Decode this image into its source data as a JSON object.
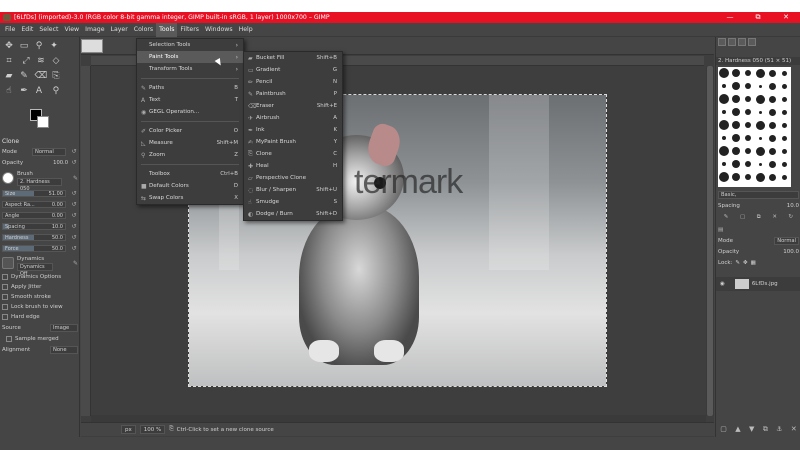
{
  "window": {
    "title": "[6LfDs] (imported)-3.0 (RGB color 8-bit gamma integer, GIMP built-in sRGB, 1 layer) 1000x700 – GIMP",
    "controls": [
      "—",
      "⧉",
      "✕"
    ]
  },
  "menubar": [
    "File",
    "Edit",
    "Select",
    "View",
    "Image",
    "Layer",
    "Colors",
    "Tools",
    "Filters",
    "Windows",
    "Help"
  ],
  "tools_menu": [
    {
      "label": "Selection Tools",
      "submenu": true
    },
    {
      "label": "Paint Tools",
      "submenu": true,
      "highlighted": true
    },
    {
      "label": "Transform Tools",
      "submenu": true
    },
    {
      "label": "Paths",
      "shortcut": "B",
      "icon": "✎"
    },
    {
      "label": "Text",
      "shortcut": "T",
      "icon": "A"
    },
    {
      "label": "GEGL Operation...",
      "icon": "◉"
    },
    {
      "label": "Color Picker",
      "shortcut": "O",
      "icon": "✐"
    },
    {
      "label": "Measure",
      "shortcut": "Shift+M",
      "icon": "◺"
    },
    {
      "label": "Zoom",
      "shortcut": "Z",
      "icon": "⚲"
    },
    {
      "label": "Toolbox",
      "shortcut": "Ctrl+B"
    },
    {
      "label": "Default Colors",
      "shortcut": "D",
      "icon": "■"
    },
    {
      "label": "Swap Colors",
      "shortcut": "X",
      "icon": "⇆"
    }
  ],
  "paint_menu": [
    {
      "label": "Bucket Fill",
      "shortcut": "Shift+B",
      "icon": "▰"
    },
    {
      "label": "Gradient",
      "shortcut": "G",
      "icon": "▭"
    },
    {
      "label": "Pencil",
      "shortcut": "N",
      "icon": "✏"
    },
    {
      "label": "Paintbrush",
      "shortcut": "P",
      "icon": "✎"
    },
    {
      "label": "Eraser",
      "shortcut": "Shift+E",
      "icon": "⌫"
    },
    {
      "label": "Airbrush",
      "shortcut": "A",
      "icon": "✈"
    },
    {
      "label": "Ink",
      "shortcut": "K",
      "icon": "✒"
    },
    {
      "label": "MyPaint Brush",
      "shortcut": "Y",
      "icon": "✍"
    },
    {
      "label": "Clone",
      "shortcut": "C",
      "icon": "⎘"
    },
    {
      "label": "Heal",
      "shortcut": "H",
      "icon": "✚"
    },
    {
      "label": "Perspective Clone",
      "shortcut": "",
      "icon": "⏥"
    },
    {
      "label": "Blur / Sharpen",
      "shortcut": "Shift+U",
      "icon": "◌"
    },
    {
      "label": "Smudge",
      "shortcut": "S",
      "icon": "☝"
    },
    {
      "label": "Dodge / Burn",
      "shortcut": "Shift+D",
      "icon": "◐"
    }
  ],
  "tool_options": {
    "title": "Clone",
    "mode_label": "Mode",
    "mode_value": "Normal",
    "opacity_label": "Opacity",
    "opacity_value": "100.0",
    "brush_label": "Brush",
    "brush_value": "2. Hardness 050",
    "sliders": [
      {
        "label": "Size",
        "value": "51.00",
        "fraction": 0.5
      },
      {
        "label": "Aspect Ra...",
        "value": "0.00",
        "fraction": 0.0
      },
      {
        "label": "Angle",
        "value": "0.00",
        "fraction": 0.0
      },
      {
        "label": "Spacing",
        "value": "10.0",
        "fraction": 0.1
      },
      {
        "label": "Hardness",
        "value": "50.0",
        "fraction": 0.5
      },
      {
        "label": "Force",
        "value": "50.0",
        "fraction": 0.5
      }
    ],
    "dynamics_label": "Dynamics",
    "dynamics_value": "Dynamics Off",
    "checks": [
      "Dynamics Options",
      "Apply Jitter",
      "Smooth stroke",
      "Lock brush to view",
      "Hard edge"
    ],
    "source_label": "Source",
    "source_value": "Image",
    "sample_merged": "Sample merged",
    "alignment_label": "Alignment",
    "alignment_value": "None"
  },
  "canvas": {
    "watermark": "termark",
    "status_unit": "px",
    "status_zoom": "100 %",
    "status_message": "Ctrl-Click to set a new clone source"
  },
  "brushes_panel": {
    "title": "2. Hardness 050 (51 × 51)",
    "tag": "Basic,",
    "spacing_label": "Spacing",
    "spacing_value": "10.0"
  },
  "layers_panel": {
    "mode_label": "Mode",
    "mode_value": "Normal",
    "opacity_label": "Opacity",
    "opacity_value": "100.0",
    "lock_label": "Lock:",
    "layer_name": "6LfDs.jpg"
  },
  "colors": {
    "titlebar": "#e81123",
    "ui_bg": "#454545",
    "highlight": "#5a5a5a"
  }
}
